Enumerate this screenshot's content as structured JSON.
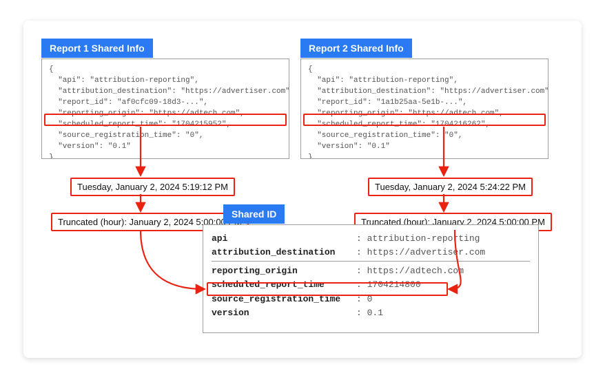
{
  "report1": {
    "title": "Report 1 Shared Info",
    "lines": [
      "{",
      "  \"api\": \"attribution-reporting\",",
      "  \"attribution_destination\": \"https://advertiser.com\",",
      "  \"report_id\": \"af0cfc09-18d3-...\",",
      "  \"reporting_origin\": \"https://adtech.com\",",
      "  \"scheduled_report_time\": \"1704215952\",",
      "  \"source_registration_time\": \"0\",",
      "  \"version\": \"0.1\"",
      "}"
    ],
    "actual_time": "Tuesday, January 2, 2024 5:19:12 PM",
    "truncated_time": "Truncated (hour): January 2, 2024 5:00:00 PM"
  },
  "report2": {
    "title": "Report 2 Shared Info",
    "lines": [
      "{",
      "  \"api\": \"attribution-reporting\",",
      "  \"attribution_destination\": \"https://advertiser.com\",",
      "  \"report_id\": \"1a1b25aa-5e1b-...\",",
      "  \"reporting_origin\": \"https://adtech.com\",",
      "  \"scheduled_report_time\": \"1704216262\",",
      "  \"source_registration_time\": \"0\",",
      "  \"version\": \"0.1\"",
      "}"
    ],
    "actual_time": "Tuesday, January 2, 2024 5:24:22 PM",
    "truncated_time": "Truncated (hour): January 2, 2024 5:00:00 PM"
  },
  "shared": {
    "title": "Shared ID",
    "rows": [
      {
        "k": "api",
        "v": "attribution-reporting"
      },
      {
        "k": "attribution_destination",
        "v": "https://advertiser.com"
      },
      {
        "sep": true
      },
      {
        "k": "reporting_origin",
        "v": "https://adtech.com"
      },
      {
        "k": "scheduled_report_time",
        "v": "1704214800",
        "hl": true
      },
      {
        "k": "source_registration_time",
        "v": "0"
      },
      {
        "k": "version",
        "v": "0.1"
      }
    ]
  }
}
